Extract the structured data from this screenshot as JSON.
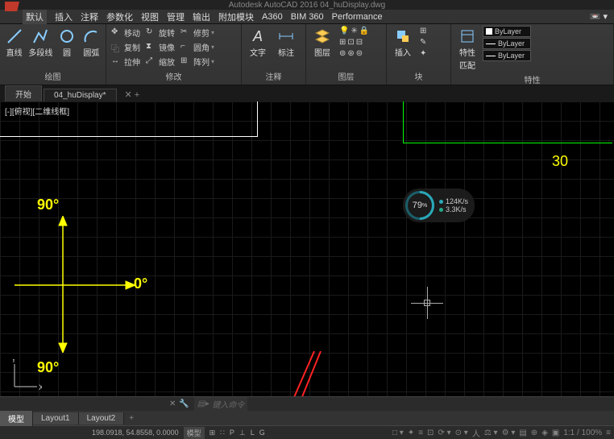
{
  "title_bar": "Autodesk AutoCAD 2016    04_huDisplay.dwg",
  "menu": {
    "tabs": [
      "默认",
      "插入",
      "注释",
      "参数化",
      "视图",
      "管理",
      "输出",
      "附加模块",
      "A360",
      "BIM 360",
      "Performance"
    ]
  },
  "ribbon": {
    "draw": {
      "line": "直线",
      "polyline": "多段线",
      "circle": "圆",
      "arc": "圆弧",
      "label": "绘图"
    },
    "modify": {
      "move": "移动",
      "rotate": "旋转",
      "trim": "修剪",
      "copy": "复制",
      "mirror": "镜像",
      "fillet": "圆角",
      "stretch": "拉伸",
      "scale": "缩放",
      "array": "阵列",
      "label": "修改"
    },
    "annot": {
      "text": "文字",
      "dim": "标注",
      "label": "注释"
    },
    "layer": {
      "btn": "图层",
      "label": "图层"
    },
    "block": {
      "btn": "插入",
      "label": "块"
    },
    "props": {
      "btn": "特性",
      "match": "匹配",
      "bylayer": "ByLayer",
      "label": "特性"
    }
  },
  "file_tabs": {
    "start": "开始",
    "doc": "04_huDisplay*"
  },
  "viewport": {
    "control": "[-][俯视][二维线框]",
    "angles": {
      "top": "90°",
      "bottom": "90°",
      "right": "0°"
    },
    "label30": "30",
    "ucs_y": "Y",
    "ucs_x": "X"
  },
  "widget": {
    "pct": "79",
    "pct_unit": "%",
    "up": "124K/s",
    "down": "3.3K/s"
  },
  "cmd": {
    "prompt": "键入命令"
  },
  "layout_tabs": {
    "model": "模型",
    "l1": "Layout1",
    "l2": "Layout2"
  },
  "status": {
    "coords": "198.0918, 54.8558, 0.0000",
    "space": "模型",
    "letters": [
      "P",
      "L",
      "G"
    ],
    "zoom": "1:1 / 100%"
  }
}
